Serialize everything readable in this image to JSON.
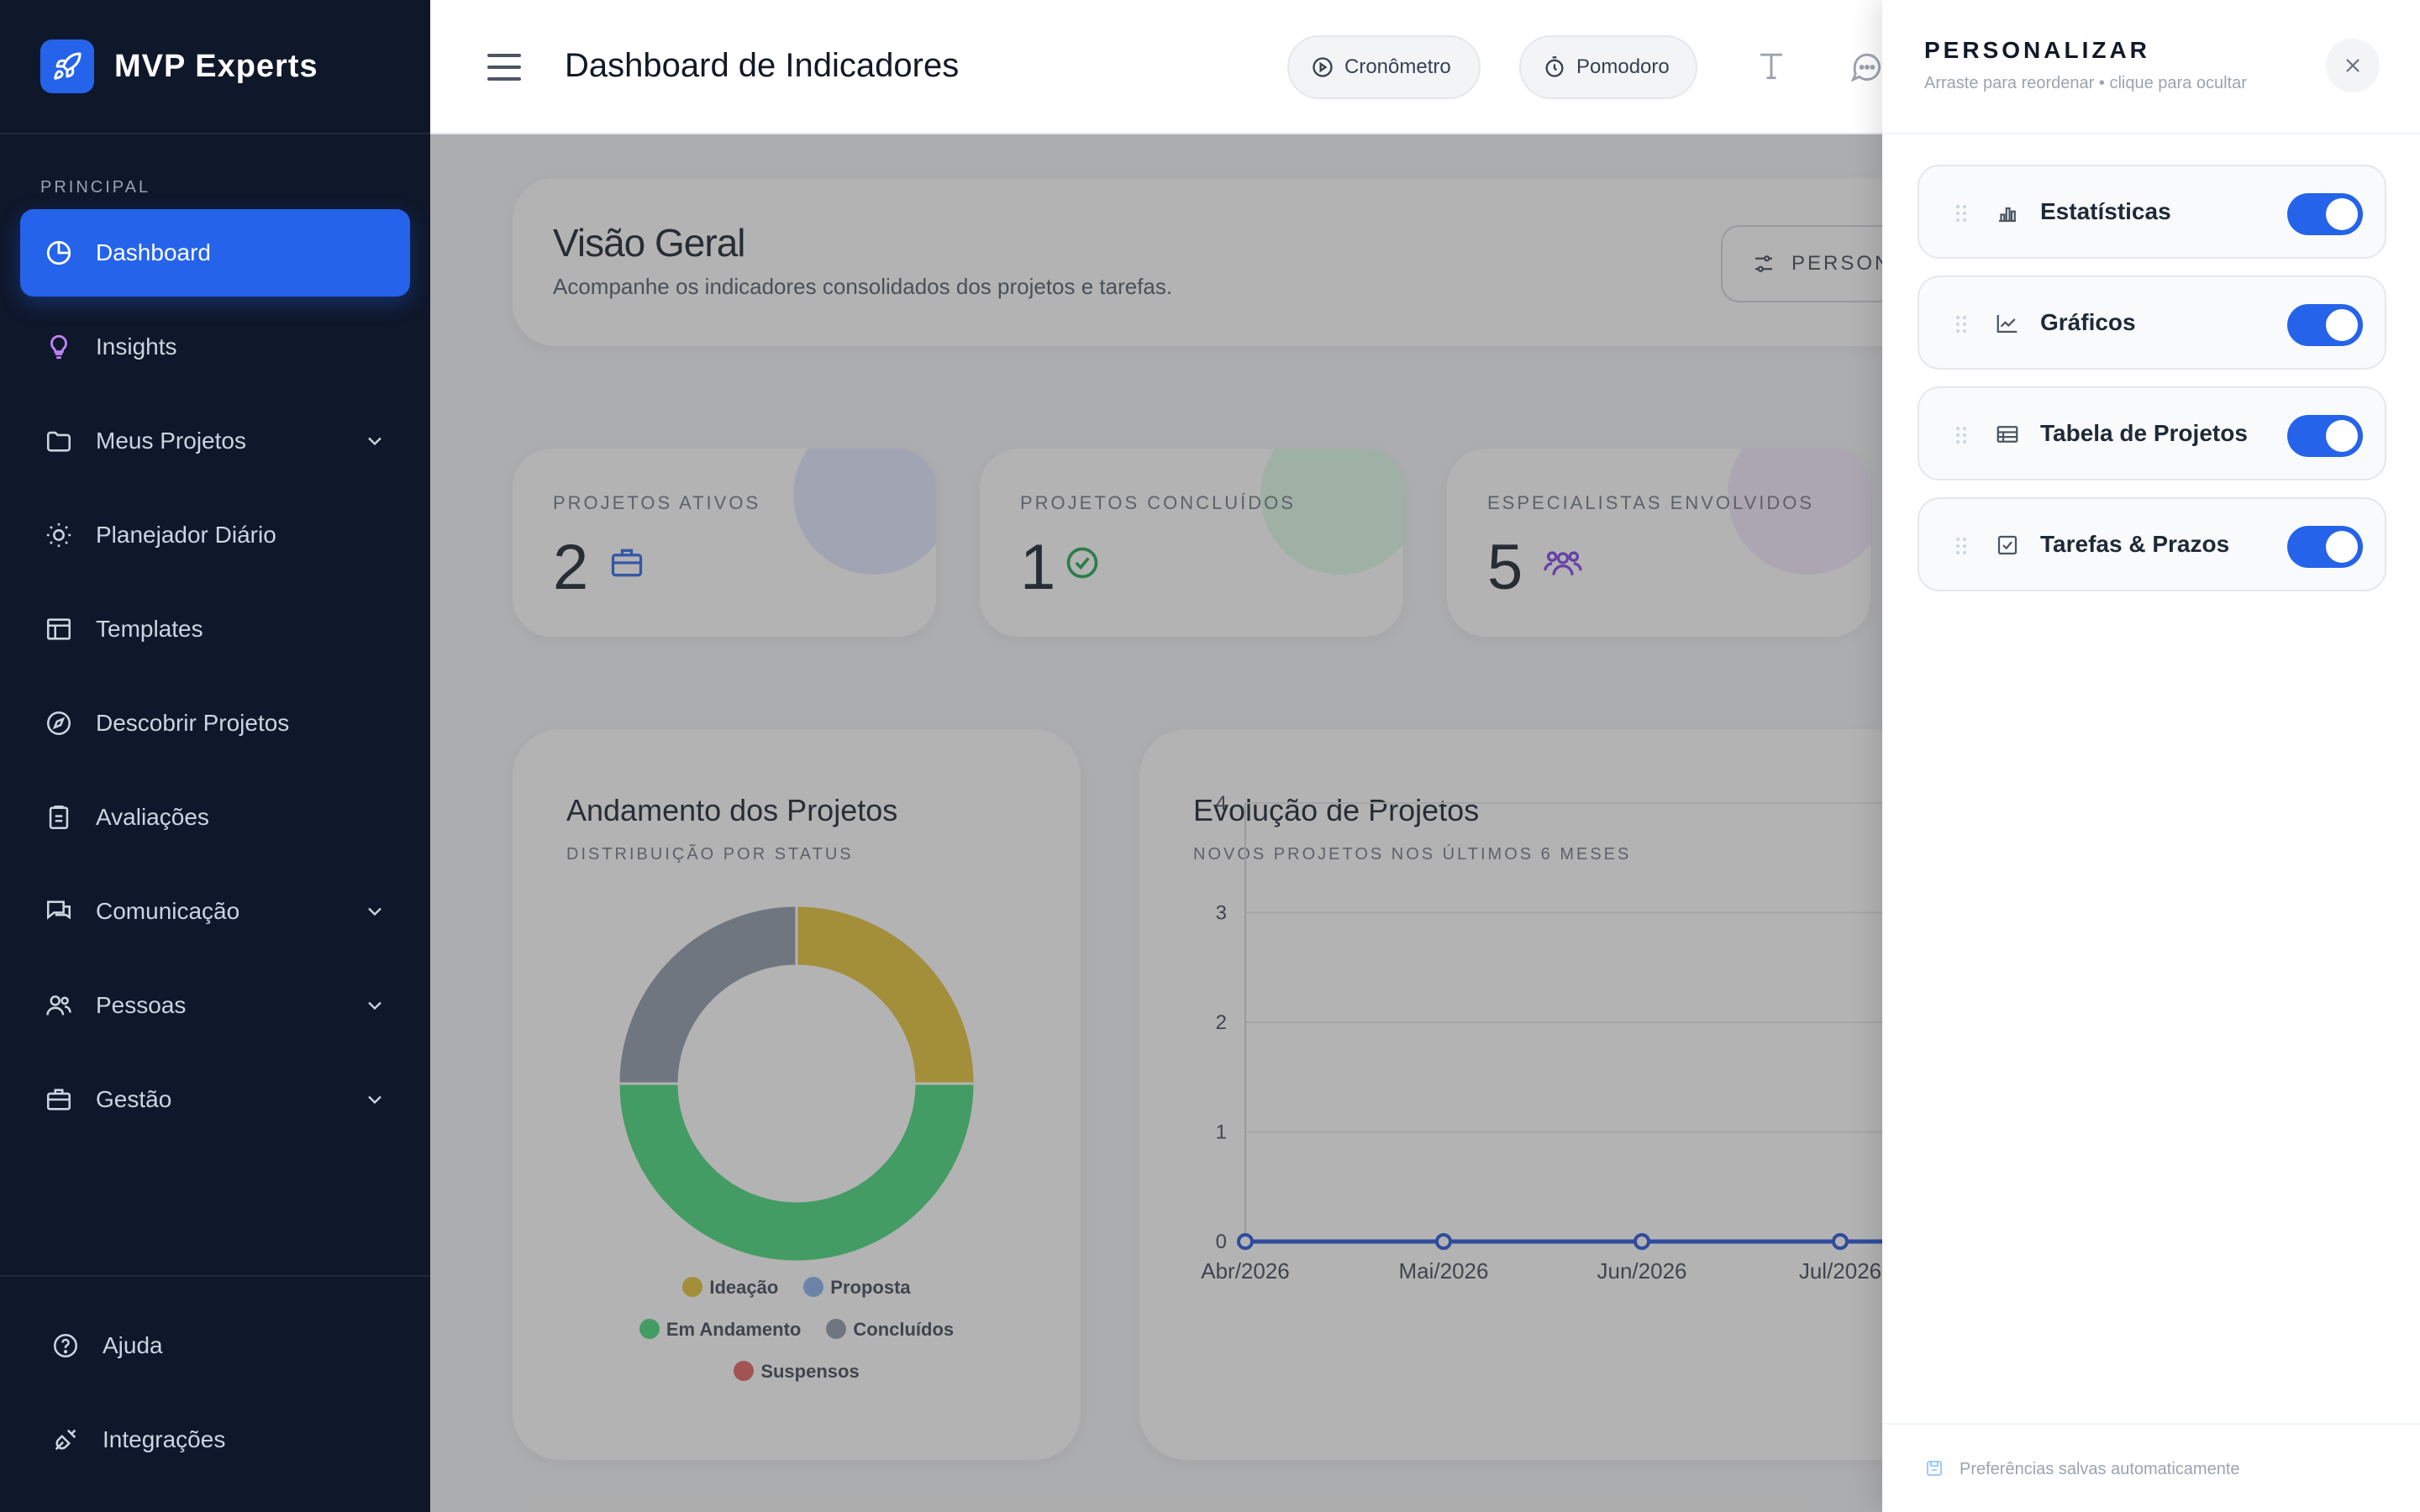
{
  "brand": {
    "name": "MVP Experts"
  },
  "sidebar": {
    "section_label": "PRINCIPAL",
    "items": [
      {
        "label": "Dashboard",
        "icon": "pie-chart-icon"
      },
      {
        "label": "Insights",
        "icon": "lightbulb-icon"
      },
      {
        "label": "Meus Projetos",
        "icon": "folder-icon"
      },
      {
        "label": "Planejador Diário",
        "icon": "sun-icon"
      },
      {
        "label": "Templates",
        "icon": "layout-icon"
      },
      {
        "label": "Descobrir Projetos",
        "icon": "compass-icon"
      },
      {
        "label": "Avaliações",
        "icon": "clipboard-icon"
      },
      {
        "label": "Comunicação",
        "icon": "chat-icon"
      },
      {
        "label": "Pessoas",
        "icon": "users-icon"
      },
      {
        "label": "Gestão",
        "icon": "briefcase-icon"
      }
    ],
    "bottom": [
      {
        "label": "Ajuda",
        "icon": "help-icon"
      },
      {
        "label": "Integrações",
        "icon": "plug-icon"
      }
    ]
  },
  "header": {
    "title": "Dashboard de Indicadores",
    "cronometro": "Cronômetro",
    "pomodoro": "Pomodoro"
  },
  "overview": {
    "title": "Visão Geral",
    "subtitle": "Acompanhe os indicadores consolidados dos projetos e tarefas.",
    "button": "PERSON"
  },
  "stats": [
    {
      "label": "PROJETOS ATIVOS",
      "value": "2",
      "icon": "briefcase-icon",
      "color": "#2563eb"
    },
    {
      "label": "PROJETOS CONCLUÍDOS",
      "value": "1",
      "icon": "check-circle-icon",
      "color": "#16a34a"
    },
    {
      "label": "ESPECIALISTAS ENVOLVIDOS",
      "value": "5",
      "icon": "users-icon",
      "color": "#7c3aed"
    }
  ],
  "chart_data": [
    {
      "type": "pie",
      "title": "Andamento dos Projetos",
      "subtitle": "DISTRIBUIÇÃO POR STATUS",
      "categories": [
        "Ideação",
        "Proposta",
        "Em Andamento",
        "Concluídos",
        "Suspensos"
      ],
      "values": [
        1,
        0,
        2,
        1,
        0
      ],
      "colors": [
        "#e3c02f",
        "#86aef0",
        "#3ed878",
        "#8b96a8",
        "#e45a5a"
      ],
      "legend_placement": "bottom"
    },
    {
      "type": "line",
      "title": "Evolução de Projetos",
      "subtitle": "NOVOS PROJETOS NOS ÚLTIMOS 6 MESES",
      "categories": [
        "Abr/2026",
        "Mai/2026",
        "Jun/2026",
        "Jul/2026"
      ],
      "series": [
        {
          "values": [
            0,
            0,
            0,
            0
          ]
        }
      ],
      "ylim": [
        0,
        4
      ],
      "yticks": [
        "0",
        "1",
        "2",
        "3",
        "4"
      ],
      "grid": true
    }
  ],
  "panel": {
    "title": "PERSONALIZAR",
    "subtitle": "Arraste para reordenar • clique para ocultar",
    "items": [
      {
        "label": "Estatísticas",
        "icon": "bar-chart-icon",
        "enabled": true
      },
      {
        "label": "Gráficos",
        "icon": "line-chart-icon",
        "enabled": true
      },
      {
        "label": "Tabela de Projetos",
        "icon": "table-icon",
        "enabled": true
      },
      {
        "label": "Tarefas & Prazos",
        "icon": "checkbox-icon",
        "enabled": true
      }
    ],
    "footer": "Preferências salvas automaticamente"
  }
}
